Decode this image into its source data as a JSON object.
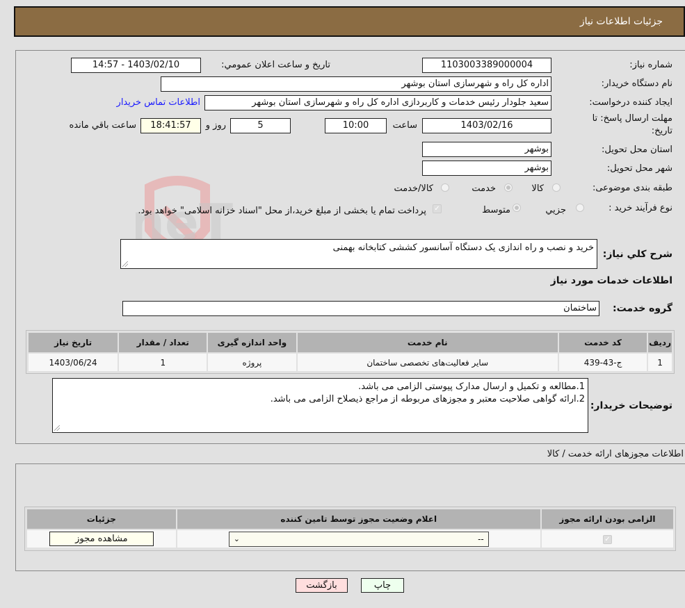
{
  "header": {
    "title": "جزئیات اطلاعات نیاز"
  },
  "form": {
    "need_number_label": "شماره نیاز:",
    "need_number": "1103003389000004",
    "announce_label": "تاریخ و ساعت اعلان عمومي:",
    "announce_value": "1403/02/10 - 14:57",
    "buyer_org_label": "نام دستگاه خریدار:",
    "buyer_org": "اداره کل راه و شهرسازی استان بوشهر",
    "creator_label": "ایجاد کننده درخواست:",
    "creator": "سعید جلودار رئیس خدمات و کاربردازی اداره کل راه و شهرسازی استان بوشهر",
    "contact_link": "اطلاعات تماس خریدار",
    "deadline_label_line1": "مهلت ارسال پاسخ: تا",
    "deadline_label_line2": "تاریخ:",
    "deadline_date": "1403/02/16",
    "time_label": "ساعت",
    "deadline_time": "10:00",
    "days_value": "5",
    "days_label": "روز و",
    "remaining_time": "18:41:57",
    "remaining_label": "ساعت باقي مانده",
    "province_label": "استان محل تحویل:",
    "province": "بوشهر",
    "city_label": "شهر محل تحویل:",
    "city": "بوشهر",
    "category_label": "طبقه بندی موضوعی:",
    "category_options": [
      {
        "label": "کالا",
        "selected": false
      },
      {
        "label": "خدمت",
        "selected": true
      },
      {
        "label": "کالا/خدمت",
        "selected": false
      }
    ],
    "process_label": "نوع فرآیند خرید :",
    "process_options": [
      {
        "label": "جزيي",
        "selected": false
      },
      {
        "label": "متوسط",
        "selected": true
      }
    ],
    "treasury_checked": true,
    "treasury_text": "پرداخت تمام یا بخشی از مبلغ خرید،از محل \"اسناد خزانه اسلامی\" خواهد بود."
  },
  "summary": {
    "label": "شرح کلي نیاز:",
    "value": "خرید و نصب و راه اندازی یک دستگاه آسانسور کششی کتابخانه بهمنی"
  },
  "services_section": {
    "title": "اطلاعات خدمات مورد نیاز",
    "group_label": "گروه خدمت:",
    "group_value": "ساختمان"
  },
  "services_table": {
    "headers": [
      "ردیف",
      "کد خدمت",
      "نام خدمت",
      "واحد اندازه گیری",
      "تعداد / مقدار",
      "تاریخ نیاز"
    ],
    "rows": [
      [
        "1",
        "ج-43-439",
        "سایر فعالیت‌های تخصصی ساختمان",
        "پروژه",
        "1",
        "1403/06/24"
      ]
    ]
  },
  "buyer_notes": {
    "label": "توضیحات خریدار:",
    "lines": [
      "1.مطالعه و تکمیل و ارسال مدارک پیوستی الزامی می باشد.",
      "2.ارائه گواهی صلاحیت معتبر و مجوزهای مربوطه از مراجع ذیصلاح الزامی می باشد."
    ]
  },
  "licenses": {
    "title": "اطلاعات مجوزهای ارائه خدمت / کالا",
    "headers": [
      "الزامی بودن ارائه مجوز",
      "اعلام وضعیت مجوز توسط تامین کننده",
      "جزئیات"
    ],
    "row": {
      "required_checked": true,
      "status_selected": "--",
      "details_button": "مشاهده مجوز"
    }
  },
  "footer": {
    "print_button": "چاپ",
    "back_button": "بازگشت"
  },
  "watermark": {
    "text": "AriaTender.neT"
  }
}
